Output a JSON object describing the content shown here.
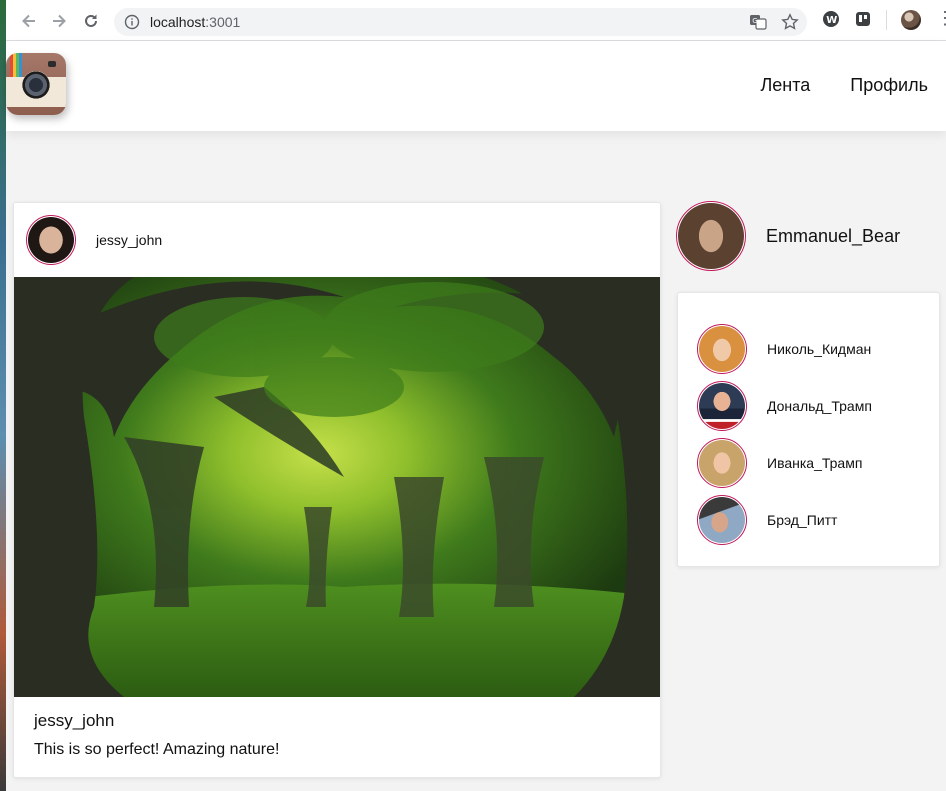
{
  "browser": {
    "url_host": "localhost",
    "url_port": ":3001"
  },
  "nav": {
    "feed": "Лента",
    "profile": "Профиль"
  },
  "post": {
    "author": "jessy_john",
    "caption_user": "jessy_john",
    "caption_text": "This is so perfect! Amazing nature!"
  },
  "current_user": {
    "name": "Emmanuel_Bear"
  },
  "suggested_users": [
    {
      "name": "Николь_Кидман"
    },
    {
      "name": "Дональд_Трамп"
    },
    {
      "name": "Иванка_Трамп"
    },
    {
      "name": "Брэд_Питт"
    }
  ],
  "colors": {
    "avatar_ring": "#c2185b",
    "background": "#f3f3f3"
  }
}
